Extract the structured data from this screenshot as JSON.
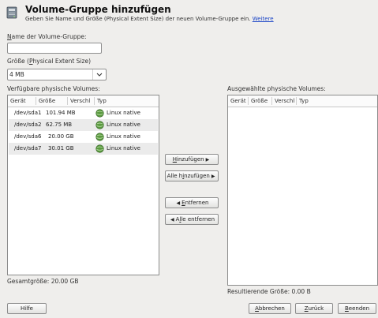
{
  "header": {
    "title": "Volume-Gruppe hinzufügen",
    "subtitle": "Geben Sie Name und Größe (Physical Extent Size) der neuen Volume-Gruppe ein.",
    "link": "Weitere"
  },
  "name_field": {
    "label_prefix": "",
    "label_key": "N",
    "label_rest": "ame der Volume-Gruppe:",
    "value": ""
  },
  "pe_size": {
    "label_pre": "Größe (",
    "label_key": "P",
    "label_rest": "hysical Extent Size)",
    "value": "4 MB"
  },
  "available": {
    "label": "Verfügbare physische Volumes:",
    "columns": [
      "Gerät",
      "Größe",
      "Verschl",
      "Typ"
    ],
    "rows": [
      {
        "device": "/dev/sda1",
        "size": "101.94 MB",
        "locked": "",
        "type": "Linux native"
      },
      {
        "device": "/dev/sda2",
        "size": "62.75 MB",
        "locked": "",
        "type": "Linux native"
      },
      {
        "device": "/dev/sda6",
        "size": "20.00 GB",
        "locked": "",
        "type": "Linux native"
      },
      {
        "device": "/dev/sda7",
        "size": "30.01 GB",
        "locked": "",
        "type": "Linux native"
      }
    ],
    "total": "Gesamtgröße: 20.00 GB"
  },
  "selected": {
    "label": "Ausgewählte physische Volumes:",
    "columns": [
      "Gerät",
      "Größe",
      "Verschl",
      "Typ"
    ],
    "resulting": "Resultierende Größe: 0.00 B"
  },
  "mid_buttons": {
    "add_key": "H",
    "add_rest": "inzufügen",
    "add_all_pre": "Alle h",
    "add_all_key": "i",
    "add_all_rest": "nzufügen",
    "remove_key": "E",
    "remove_rest": "ntfernen",
    "remove_all_pre": "A",
    "remove_all_key": "l",
    "remove_all_rest": "le entfernen"
  },
  "footer": {
    "help": "Hilfe",
    "cancel_key": "A",
    "cancel_rest": "bbrechen",
    "back_key": "Z",
    "back_rest": "urück",
    "finish_key": "B",
    "finish_rest": "eenden"
  },
  "colors": {
    "link": "#1a44c6",
    "window_bg": "#efeeec",
    "row_alt": "#ebebeb"
  }
}
